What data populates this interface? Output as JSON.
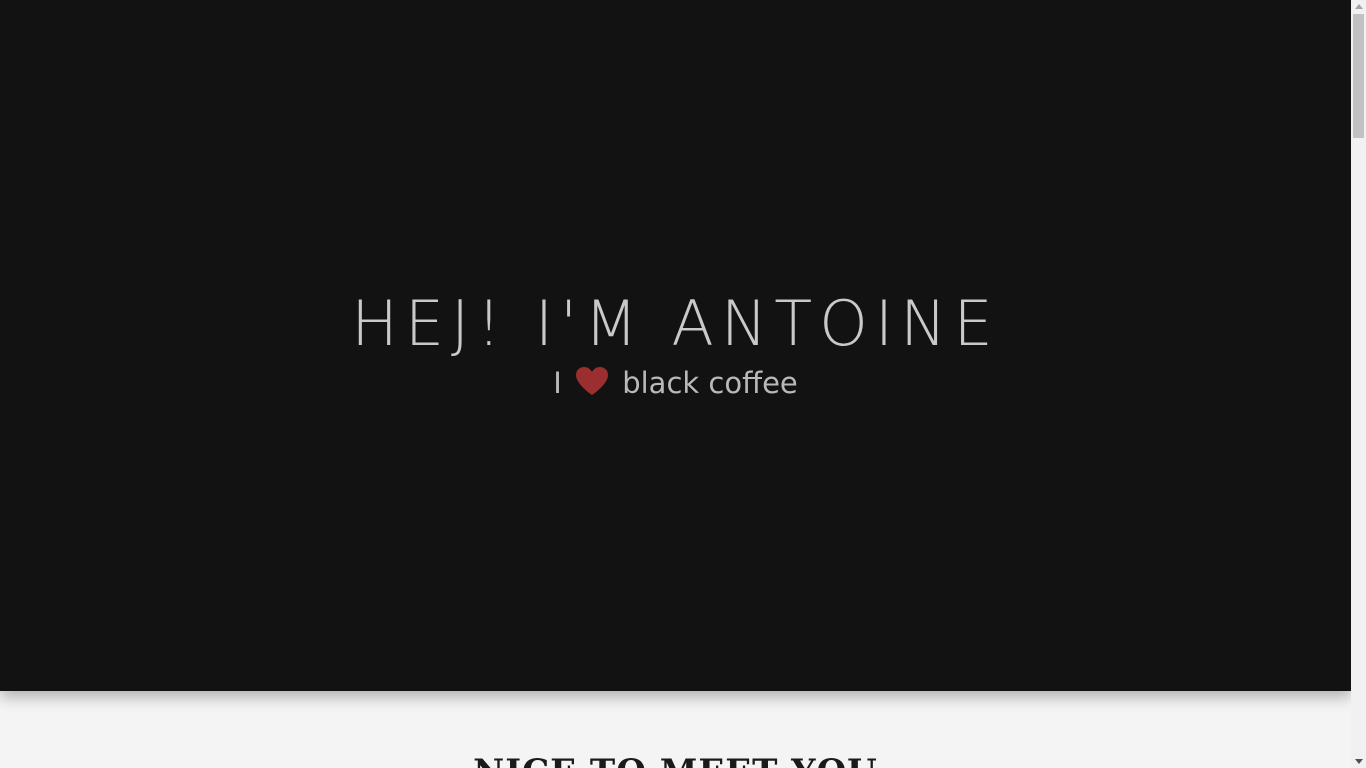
{
  "hero": {
    "title": "HEJ! I'M ANTOINE",
    "tagline": {
      "prefix": "I",
      "icon": "heart-icon",
      "suffix": "black coffee"
    }
  },
  "about": {
    "title": "NICE TO MEET YOU"
  },
  "colors": {
    "hero_background": "#121212",
    "page_background": "#f4f4f4",
    "heart": "#9b2f2f",
    "title_text": "#c9c9c9"
  }
}
